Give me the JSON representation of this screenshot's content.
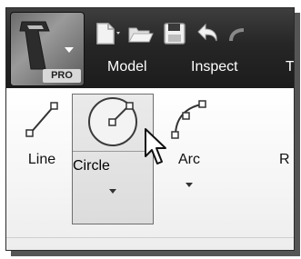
{
  "app": {
    "badge": "PRO",
    "logo_icon": "inventor-logo-icon",
    "menu_caret_icon": "chevron-down-icon"
  },
  "quick_access": [
    {
      "icon": "new-file-icon"
    },
    {
      "icon": "open-folder-icon"
    },
    {
      "icon": "save-icon"
    },
    {
      "icon": "undo-icon"
    }
  ],
  "tabs": [
    {
      "label": "Model"
    },
    {
      "label": "Inspect"
    },
    {
      "label": "T"
    }
  ],
  "ribbon": {
    "tools": [
      {
        "label": "Line",
        "icon": "line-tool-icon"
      },
      {
        "label": "Circle",
        "icon": "circle-tool-icon"
      },
      {
        "label": "Arc",
        "icon": "arc-tool-icon"
      },
      {
        "label": "R",
        "icon": ""
      }
    ]
  },
  "cursor": {
    "icon": "mouse-pointer-icon"
  }
}
